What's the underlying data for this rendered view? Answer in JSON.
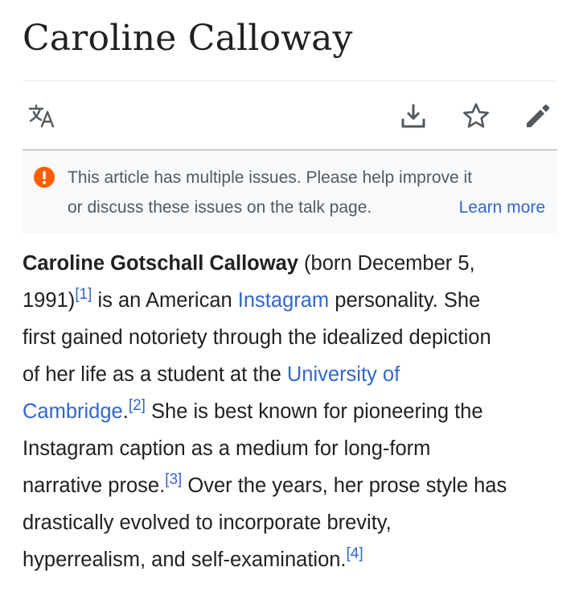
{
  "page": {
    "title": "Caroline Calloway"
  },
  "toolbar": {
    "language_icon": "translate-icon",
    "download_icon": "download-icon",
    "watch_icon": "star-icon",
    "edit_icon": "pencil-icon"
  },
  "notice": {
    "icon": "exclamation-circle-icon",
    "icon_color": "#ff5d00",
    "line1": "This article has multiple issues. Please help improve it",
    "line2": "or discuss these issues on the talk page.",
    "learn_more": "Learn more"
  },
  "article": {
    "lines": [
      {
        "bold": "Caroline Gotschall Calloway",
        "text": " (born December 5,"
      },
      {
        "text_a": "1991)",
        "ref": "[1]",
        "text_b": " is an American ",
        "link": "Instagram",
        "text_c": " personality. She"
      },
      {
        "text": "first gained notoriety through the idealized depiction"
      },
      {
        "text": "of her life as a student at the ",
        "link": "University of"
      },
      {
        "link": "Cambridge",
        "text_a": ".",
        "ref": "[2]",
        "text_b": " She is best known for pioneering the"
      },
      {
        "text": "Instagram caption as a medium for long-form"
      },
      {
        "text_a": "narrative prose.",
        "ref": "[3]",
        "text_b": " Over the years, her prose style has"
      },
      {
        "text": "drastically evolved to incorporate brevity,"
      },
      {
        "text_a": "hyperrealism, and self-examination.",
        "ref": "[4]"
      }
    ]
  },
  "colors": {
    "link": "#3366cc",
    "text": "#202122",
    "notice_text": "#54595d",
    "notice_bg": "#f8f9fa",
    "icon": "#54595d"
  }
}
